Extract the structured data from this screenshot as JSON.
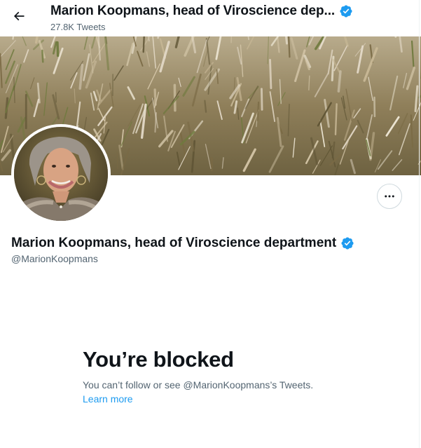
{
  "header": {
    "back_icon": "arrow-left-icon",
    "title": "Marion Koopmans, head of Viroscience dep...",
    "tweet_count": "27.8K Tweets"
  },
  "profile": {
    "display_name": "Marion Koopmans, head of Viroscience department",
    "handle": "@MarionKoopmans",
    "verified": true,
    "more_icon": "more-horizontal-icon"
  },
  "blocked": {
    "title": "You’re blocked",
    "message": "You can’t follow or see @MarionKoopmans’s Tweets.",
    "learn_more": "Learn more"
  },
  "colors": {
    "accent": "#1d9bf0",
    "secondary_text": "#536471",
    "primary_text": "#0f1419"
  }
}
